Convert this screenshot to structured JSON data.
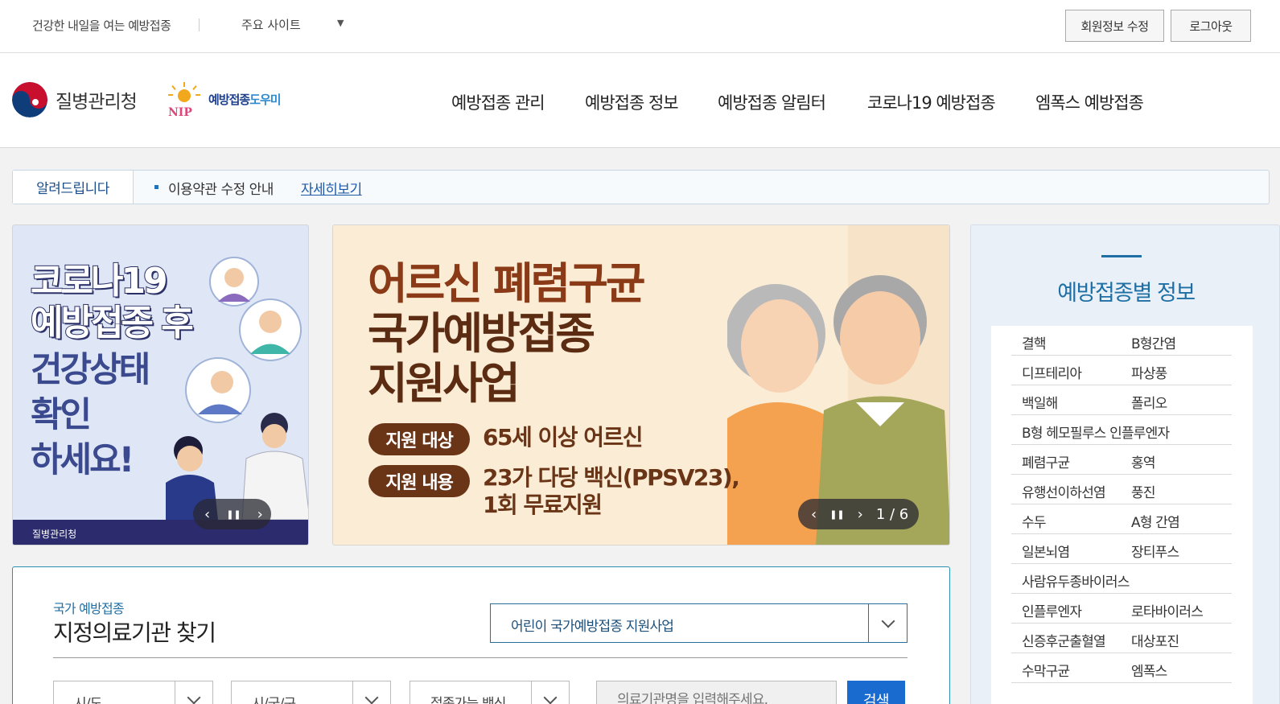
{
  "topbar": {
    "slogan": "건강한 내일을 여는 예방접종",
    "sites_label": "주요 사이트",
    "sites_arrow": "▼",
    "edit_profile": "회원정보 수정",
    "logout": "로그아웃"
  },
  "header": {
    "agency_name": "질병관리청",
    "nip_logo": {
      "main": "예방접종",
      "accent": "도우미",
      "letters": "NIP"
    },
    "nav": [
      "예방접종 관리",
      "예방접종 정보",
      "예방접종 알림터",
      "코로나19 예방접종",
      "엠폭스 예방접종"
    ]
  },
  "notice": {
    "label": "알려드립니다",
    "message": "이용약관 수정 안내",
    "more": "자세히보기"
  },
  "banner1": {
    "headline": [
      "코로나19",
      "예방접종 후"
    ],
    "sub": [
      "건강상태",
      "확인",
      "하세요!"
    ],
    "footer_logo": "질병관리청",
    "controls": {
      "prev": "‹",
      "pause": "❚❚",
      "next": "›"
    }
  },
  "banner2": {
    "title": [
      "어르신 폐렴구균",
      "국가예방접종",
      "지원사업"
    ],
    "target_label": "지원 대상",
    "target_value": "65세 이상 어르신",
    "content_label": "지원 내용",
    "content_value": [
      "23가 다당 백신(PPSV23),",
      "1회 무료지원"
    ],
    "controls": {
      "prev": "‹",
      "pause": "❚❚",
      "next": "›",
      "counter": "1 / 6"
    }
  },
  "side_panel": {
    "title": "예방접종별 정보",
    "rows": [
      [
        "결핵",
        "B형간염"
      ],
      [
        "디프테리아",
        "파상풍"
      ],
      [
        "백일해",
        "폴리오"
      ],
      [
        "B형 헤모필루스 인플루엔자",
        ""
      ],
      [
        "폐렴구균",
        "홍역"
      ],
      [
        "유행선이하선염",
        "풍진"
      ],
      [
        "수두",
        "A형 간염"
      ],
      [
        "일본뇌염",
        "장티푸스"
      ],
      [
        "사람유두종바이러스",
        ""
      ],
      [
        "인플루엔자",
        "로타바이러스"
      ],
      [
        "신증후군출혈열",
        "대상포진"
      ],
      [
        "수막구균",
        "엠폭스"
      ]
    ]
  },
  "finder": {
    "kicker": "국가 예방접종",
    "heading": "지정의료기관 찾기",
    "program_select": "어린이 국가예방접종 지원사업",
    "selects": [
      "시/도",
      "시/군/구",
      "접종가능 백신"
    ],
    "search_placeholder": "의료기관명을 입력해주세요.",
    "search_button": "검색"
  }
}
